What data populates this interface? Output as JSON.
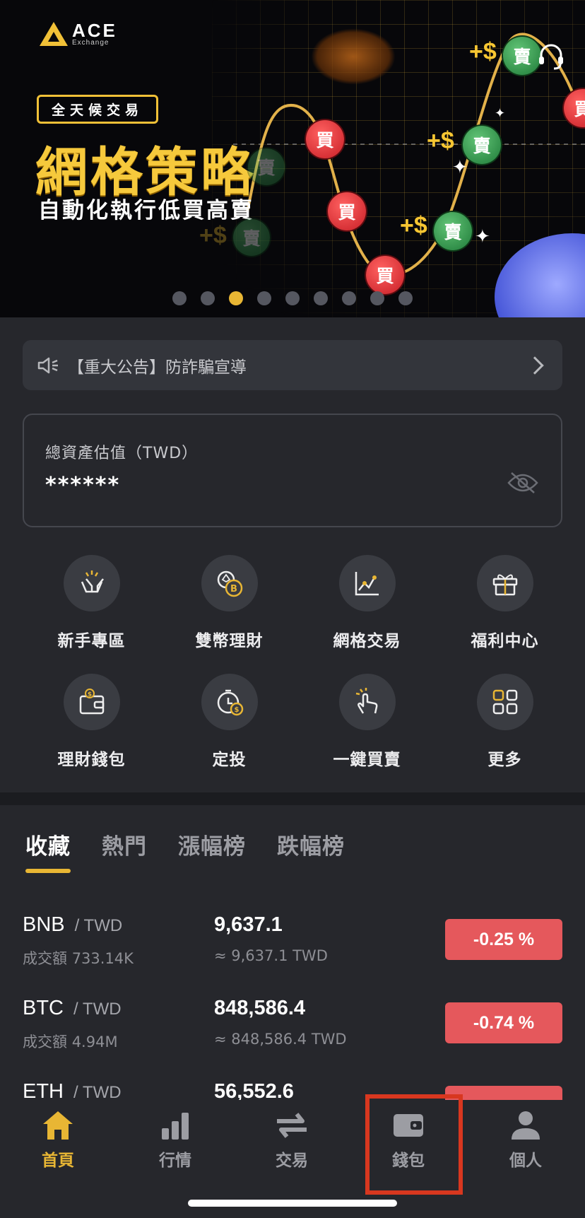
{
  "banner": {
    "logo_name": "ACE",
    "logo_sub": "Exchange",
    "tag": "全天候交易",
    "headline": "網格策略",
    "subline": "自動化執行低買高賣",
    "buy_glyph": "買",
    "sell_glyph": "賣",
    "plus_text": "+$",
    "carousel_total": 9,
    "carousel_active": 3
  },
  "notice": {
    "text": "【重大公告】防詐騙宣導"
  },
  "asset": {
    "label": "總資產估值（TWD）",
    "value": "******"
  },
  "quick_menu": [
    {
      "label": "新手專區",
      "icon": "hands-icon"
    },
    {
      "label": "雙幣理財",
      "icon": "dual-coin-icon"
    },
    {
      "label": "網格交易",
      "icon": "grid-chart-icon"
    },
    {
      "label": "福利中心",
      "icon": "gift-icon"
    },
    {
      "label": "理財錢包",
      "icon": "wallet-dollar-icon"
    },
    {
      "label": "定投",
      "icon": "stopwatch-coin-icon"
    },
    {
      "label": "一鍵買賣",
      "icon": "tap-hand-icon"
    },
    {
      "label": "更多",
      "icon": "grid-more-icon"
    }
  ],
  "tabs": [
    "收藏",
    "熱門",
    "漲幅榜",
    "跌幅榜"
  ],
  "market": {
    "rows": [
      {
        "base": "BNB",
        "quote": "/ TWD",
        "vol_label": "成交額",
        "vol": "733.14K",
        "price": "9,637.1",
        "approx": "≈ 9,637.1 TWD",
        "change": "-0.25 %"
      },
      {
        "base": "BTC",
        "quote": "/ TWD",
        "vol_label": "成交額",
        "vol": "4.94M",
        "price": "848,586.4",
        "approx": "≈ 848,586.4 TWD",
        "change": "-0.74 %"
      },
      {
        "base": "ETH",
        "quote": "/ TWD",
        "vol_label": "",
        "vol": "",
        "price": "56,552.6",
        "approx": "",
        "change": ""
      }
    ]
  },
  "nav": [
    {
      "label": "首頁",
      "icon": "home-icon",
      "active": true
    },
    {
      "label": "行情",
      "icon": "bar-chart-icon",
      "active": false
    },
    {
      "label": "交易",
      "icon": "swap-arrows-icon",
      "active": false
    },
    {
      "label": "錢包",
      "icon": "wallet-icon",
      "active": false
    },
    {
      "label": "個人",
      "icon": "person-icon",
      "active": false
    }
  ],
  "colors": {
    "accent": "#e8b634",
    "negative": "#e5585c",
    "background": "#26272c"
  }
}
